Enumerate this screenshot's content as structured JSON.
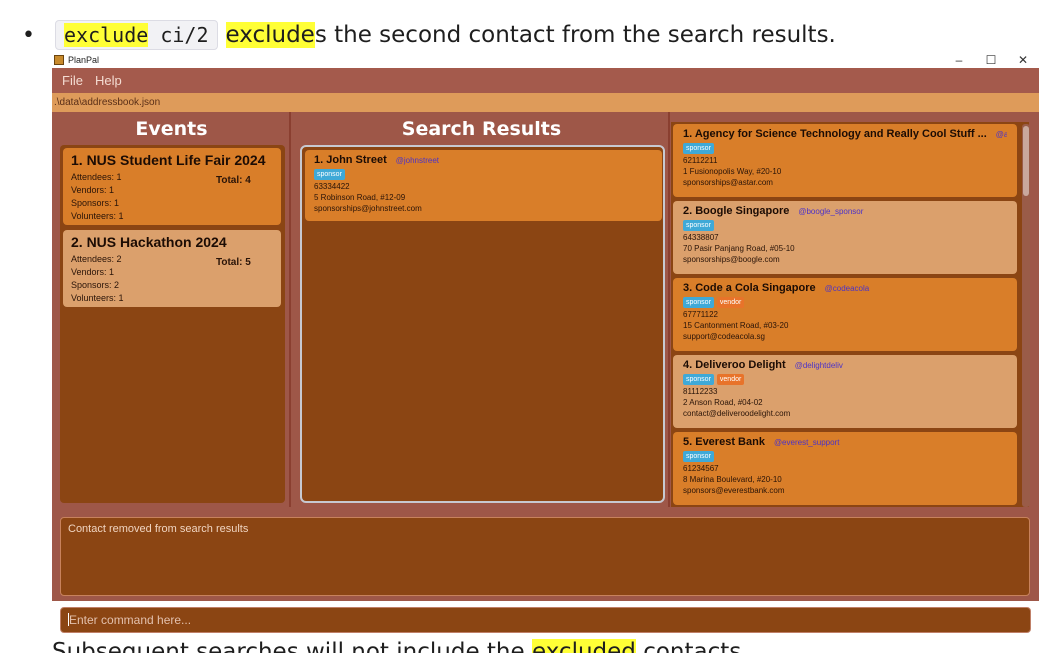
{
  "doc": {
    "bullet": "•",
    "code": "exclude ci/2",
    "highlight_word": "exclude",
    "rest": "s the second contact from the search results.",
    "bottom_text_pre": "Subsequent searches will not include the ",
    "bottom_text_hl": "excluded",
    "bottom_text_post": " contacts."
  },
  "window": {
    "title": "PlanPal",
    "controls": {
      "minimize": "–",
      "maximize": "☐",
      "close": "✕"
    },
    "menu": [
      "File",
      "Help"
    ],
    "path": ".\\data\\addressbook.json"
  },
  "events": {
    "title": "Events",
    "items": [
      {
        "name": "1. NUS Student Life Fair 2024",
        "attendees": "Attendees: 1",
        "vendors": "Vendors: 1",
        "sponsors": "Sponsors: 1",
        "volunteers": "Volunteers: 1",
        "total": "Total: 4"
      },
      {
        "name": "2. NUS Hackathon 2024",
        "attendees": "Attendees: 2",
        "vendors": "Vendors: 1",
        "sponsors": "Sponsors: 2",
        "volunteers": "Volunteers: 1",
        "total": "Total: 5"
      }
    ]
  },
  "search": {
    "title": "Search Results",
    "results": [
      {
        "name": "1. John Street",
        "handle": "@johnstreet",
        "tags": [
          "sponsor"
        ],
        "phone": "63334422",
        "address": "5 Robinson Road, #12-09",
        "email": "sponsorships@johnstreet.com"
      }
    ]
  },
  "contacts": [
    {
      "name": "1. Agency for Science Technology and Really Cool Stuff ...",
      "handle": "@astar...",
      "tags": [
        "sponsor"
      ],
      "phone": "62112211",
      "address": "1 Fusionopolis Way, #20-10",
      "email": "sponsorships@astar.com"
    },
    {
      "name": "2. Boogle Singapore",
      "handle": "@boogle_sponsor",
      "tags": [
        "sponsor"
      ],
      "phone": "64338807",
      "address": "70 Pasir Panjang Road, #05-10",
      "email": "sponsorships@boogle.com"
    },
    {
      "name": "3. Code a Cola Singapore",
      "handle": "@codeacola",
      "tags": [
        "sponsor",
        "vendor"
      ],
      "phone": "67771122",
      "address": "15 Cantonment Road, #03-20",
      "email": "support@codeacola.sg"
    },
    {
      "name": "4. Deliveroo Delight",
      "handle": "@delightdeliv",
      "tags": [
        "sponsor",
        "vendor"
      ],
      "phone": "81112233",
      "address": "2 Anson Road, #04-02",
      "email": "contact@deliveroodelight.com"
    },
    {
      "name": "5. Everest Bank",
      "handle": "@everest_support",
      "tags": [
        "sponsor"
      ],
      "phone": "61234567",
      "address": "8 Marina Boulevard, #20-10",
      "email": "sponsors@everestbank.com"
    }
  ],
  "result_display": "Contact removed from search results",
  "command": {
    "placeholder": "Enter command here..."
  },
  "colors": {
    "window_bg": "#9e5748",
    "panel_bg": "#8b4513",
    "card_dark": "#d97e29",
    "card_light": "#dba06c",
    "tag_sponsor": "#3fa9d7",
    "tag_vendor": "#e8732a",
    "handle": "#4b32c8",
    "highlight": "#ffff36"
  }
}
